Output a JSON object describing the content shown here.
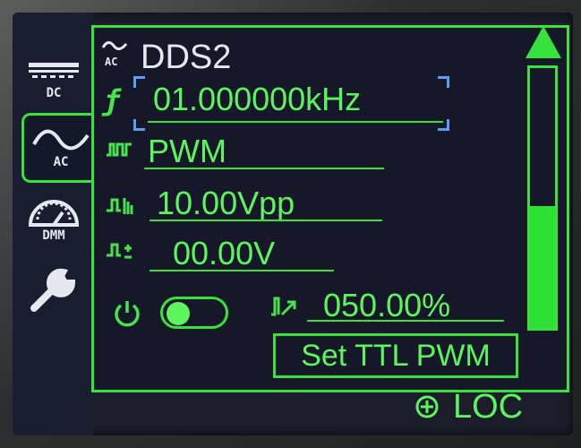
{
  "sidebar": {
    "tabs": [
      {
        "label": "DC",
        "icon": "dc-icon"
      },
      {
        "label": "AC",
        "icon": "sine-wave-icon"
      },
      {
        "label": "DMM",
        "icon": "gauge-icon"
      },
      {
        "label": "",
        "icon": "wrench-icon"
      }
    ],
    "active_tab": "AC"
  },
  "panel": {
    "title": "DDS2",
    "title_icon": "ac-sine-icon",
    "frequency": {
      "value": "01.000000kHz",
      "icon": "frequency-f-icon"
    },
    "waveform": {
      "value": "PWM",
      "icon": "pwm-wave-icon"
    },
    "amplitude": {
      "value": "10.00Vpp",
      "icon": "amplitude-icon"
    },
    "offset": {
      "value": "00.00V",
      "icon": "offset-icon"
    },
    "output": {
      "icon": "power-icon",
      "state": "off"
    },
    "duty_cycle": {
      "value": "050.00%",
      "icon": "duty-cycle-icon"
    },
    "set_ttl_button": "Set TTL PWM"
  },
  "scrollbar": {
    "position_fraction": 0.47
  },
  "status": {
    "icon": "crosshair-icon",
    "text": "LOC"
  },
  "colors": {
    "accent": "#36e23c",
    "text": "#5cf55e",
    "background": "#16182a"
  }
}
